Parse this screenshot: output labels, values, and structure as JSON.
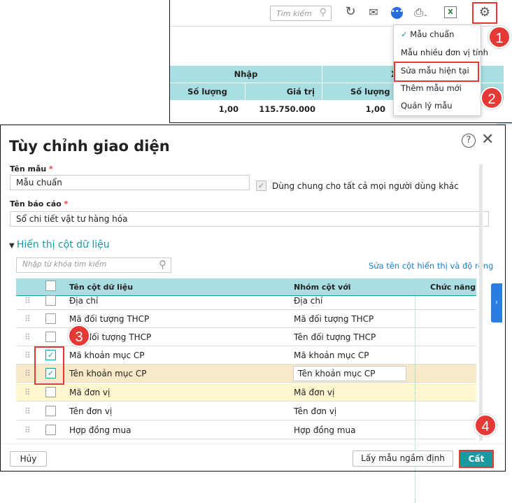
{
  "toolbar": {
    "search_placeholder": "Tìm kiếm",
    "icons": [
      "refresh-icon",
      "mail-icon",
      "chat-icon",
      "print-icon",
      "excel-icon",
      "gear-icon"
    ]
  },
  "report_table": {
    "group_headers": [
      "Nhập",
      "Xuất"
    ],
    "sub_headers": [
      "Số lượng",
      "Giá trị",
      "Số lượng"
    ],
    "row": [
      "1,00",
      "115.750.000",
      "1,00"
    ]
  },
  "template_menu": {
    "items": [
      {
        "label": "Mẫu chuẩn",
        "checked": true
      },
      {
        "label": "Mẫu nhiều đơn vị tính"
      },
      {
        "label": "Sửa mẫu hiện tại"
      },
      {
        "label": "Thêm mẫu mới"
      },
      {
        "label": "Quản lý mẫu"
      }
    ]
  },
  "badges": [
    "1",
    "2",
    "3",
    "4"
  ],
  "dialog": {
    "title": "Tùy chỉnh giao diện",
    "template_name_label": "Tên mẫu",
    "template_name_value": "Mẫu chuẩn",
    "share_label": "Dùng chung cho tất cả mọi người dùng khác",
    "report_name_label": "Tên báo cáo",
    "report_name_value": "Sổ chi tiết vật tư hàng hóa",
    "required_mark": "*",
    "section_title": "Hiển thị cột dữ liệu",
    "column_search_placeholder": "Nhập từ khóa tìm kiếm",
    "edit_columns_link": "Sửa tên cột hiển thị và độ rộng",
    "columns_header": {
      "name": "Tên cột dữ liệu",
      "group": "Nhóm cột với",
      "action": "Chức năng"
    },
    "rows": [
      {
        "name": "Địa chỉ",
        "group": "Địa chỉ",
        "checked": false
      },
      {
        "name": "Mã đối tượng THCP",
        "group": "Mã đối tượng THCP",
        "checked": false
      },
      {
        "name": "Tên đối tượng THCP",
        "group": "Tên đối tượng THCP",
        "checked": false
      },
      {
        "name": "Mã khoản mục CP",
        "group": "Mã khoản mục CP",
        "checked": true
      },
      {
        "name": "Tên khoản mục CP",
        "group": "Tên khoản mục CP",
        "checked": true
      },
      {
        "name": "Mã đơn vị",
        "group": "Mã đơn vị",
        "checked": false
      },
      {
        "name": "Tên đơn vị",
        "group": "Tên đơn vị",
        "checked": false
      },
      {
        "name": "Hợp đồng mua",
        "group": "Hợp đồng mua",
        "checked": false
      }
    ],
    "cancel_label": "Hủy",
    "default_label": "Lấy mẫu ngầm định",
    "save_label": "Cất"
  },
  "colors": {
    "accent": "#1a9aa0",
    "header": "#a9dfe3",
    "highlight": "#e53935"
  }
}
